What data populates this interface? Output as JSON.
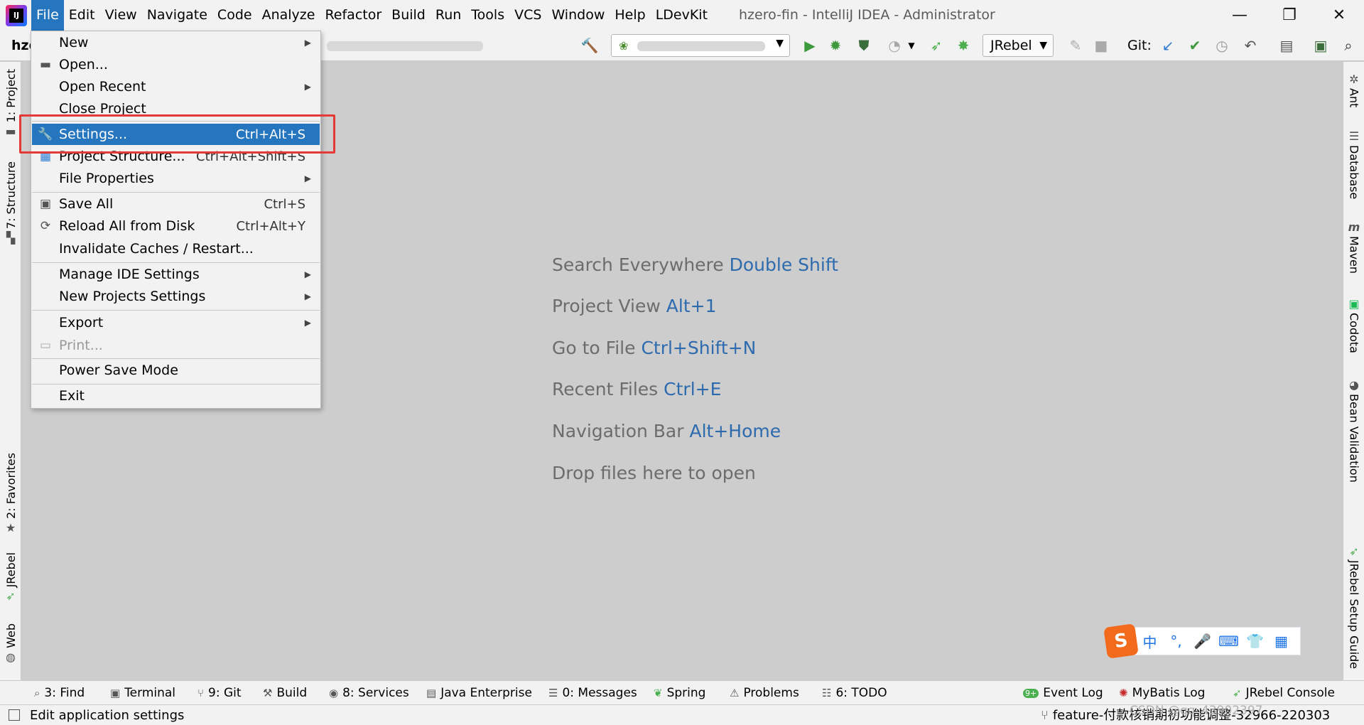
{
  "app": {
    "logo_text": "IJ",
    "window_title": "hzero-fin - IntelliJ IDEA - Administrator"
  },
  "menubar": {
    "items": [
      "File",
      "Edit",
      "View",
      "Navigate",
      "Code",
      "Analyze",
      "Refactor",
      "Build",
      "Run",
      "Tools",
      "VCS",
      "Window",
      "Help",
      "LDevKit"
    ],
    "active_index": 0
  },
  "window_controls": {
    "minimize": "—",
    "restore": "❐",
    "close": "✕"
  },
  "toolbar": {
    "breadcrumb": "hze",
    "jrebel_select": "JRebel",
    "git_label": "Git:"
  },
  "file_menu": {
    "items": [
      {
        "label": "New",
        "shortcut": "",
        "submenu": true,
        "icon": ""
      },
      {
        "label": "Open...",
        "shortcut": "",
        "submenu": false,
        "icon": "folder-icon"
      },
      {
        "label": "Open Recent",
        "shortcut": "",
        "submenu": true,
        "icon": ""
      },
      {
        "label": "Close Project",
        "shortcut": "",
        "submenu": false,
        "icon": ""
      },
      {
        "label": "Settings...",
        "shortcut": "Ctrl+Alt+S",
        "submenu": false,
        "icon": "wrench-icon",
        "selected": true
      },
      {
        "label": "Project Structure...",
        "shortcut": "Ctrl+Alt+Shift+S",
        "submenu": false,
        "icon": "project-structure-icon"
      },
      {
        "label": "File Properties",
        "shortcut": "",
        "submenu": true,
        "icon": ""
      },
      {
        "label": "Save All",
        "shortcut": "Ctrl+S",
        "submenu": false,
        "icon": "save-icon"
      },
      {
        "label": "Reload All from Disk",
        "shortcut": "Ctrl+Alt+Y",
        "submenu": false,
        "icon": "reload-icon"
      },
      {
        "label": "Invalidate Caches / Restart...",
        "shortcut": "",
        "submenu": false,
        "icon": ""
      },
      {
        "label": "Manage IDE Settings",
        "shortcut": "",
        "submenu": true,
        "icon": ""
      },
      {
        "label": "New Projects Settings",
        "shortcut": "",
        "submenu": true,
        "icon": ""
      },
      {
        "label": "Export",
        "shortcut": "",
        "submenu": true,
        "icon": ""
      },
      {
        "label": "Print...",
        "shortcut": "",
        "submenu": false,
        "icon": "print-icon",
        "disabled": true
      },
      {
        "label": "Power Save Mode",
        "shortcut": "",
        "submenu": false,
        "icon": ""
      },
      {
        "label": "Exit",
        "shortcut": "",
        "submenu": false,
        "icon": ""
      }
    ]
  },
  "left_stripe": {
    "tabs": [
      "1: Project",
      "7: Structure",
      "2: Favorites",
      "JRebel",
      "Web"
    ]
  },
  "right_stripe": {
    "tabs": [
      "Ant",
      "Database",
      "Maven",
      "Codota",
      "Bean Validation",
      "JRebel Setup Guide"
    ]
  },
  "editor_hints": [
    {
      "text": "Search Everywhere",
      "key": "Double Shift"
    },
    {
      "text": "Project View",
      "key": "Alt+1"
    },
    {
      "text": "Go to File",
      "key": "Ctrl+Shift+N"
    },
    {
      "text": "Recent Files",
      "key": "Ctrl+E"
    },
    {
      "text": "Navigation Bar",
      "key": "Alt+Home"
    },
    {
      "text": "Drop files here to open",
      "key": ""
    }
  ],
  "bottom_tools": {
    "left": [
      "3: Find",
      "Terminal",
      "9: Git",
      "Build",
      "8: Services",
      "Java Enterprise",
      "0: Messages",
      "Spring",
      "Problems",
      "6: TODO"
    ],
    "right": [
      "Event Log",
      "MyBatis Log",
      "JRebel Console"
    ],
    "event_log_badge": "9+"
  },
  "status": {
    "text": "Edit application settings",
    "branch": "feature-付款核销期初功能调整-32966-220303"
  },
  "ime": {
    "logo": "S",
    "items": [
      "中",
      "°,",
      "🎤",
      "⌨",
      "👕",
      "▦"
    ]
  },
  "watermark": "CSDN @qq_43902397",
  "colors": {
    "accent": "#2675bf",
    "hint_key": "#2d6aae",
    "highlight_box": "#e53935"
  }
}
